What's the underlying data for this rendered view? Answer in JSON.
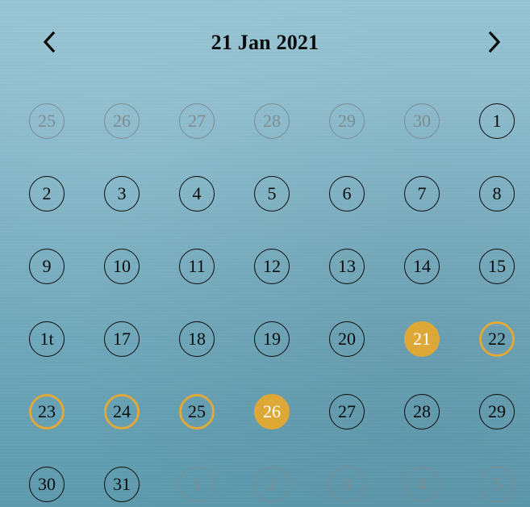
{
  "header": {
    "title": "21 Jan 2021",
    "prev_icon": "chevron-left-icon",
    "next_icon": "chevron-right-icon"
  },
  "colors": {
    "accent": "#dea836",
    "ring": "#e0a83a",
    "muted": "#7d8d92",
    "text": "#0b0b0b"
  },
  "weeks": [
    [
      {
        "label": "25",
        "state": "muted"
      },
      {
        "label": "26",
        "state": "muted"
      },
      {
        "label": "27",
        "state": "muted"
      },
      {
        "label": "28",
        "state": "muted"
      },
      {
        "label": "29",
        "state": "muted"
      },
      {
        "label": "30",
        "state": "muted"
      },
      {
        "label": "1",
        "state": "normal"
      }
    ],
    [
      {
        "label": "2",
        "state": "normal"
      },
      {
        "label": "3",
        "state": "normal"
      },
      {
        "label": "4",
        "state": "normal"
      },
      {
        "label": "5",
        "state": "normal"
      },
      {
        "label": "6",
        "state": "normal"
      },
      {
        "label": "7",
        "state": "normal"
      },
      {
        "label": "8",
        "state": "normal"
      }
    ],
    [
      {
        "label": "9",
        "state": "normal"
      },
      {
        "label": "10",
        "state": "normal"
      },
      {
        "label": "11",
        "state": "normal"
      },
      {
        "label": "12",
        "state": "normal"
      },
      {
        "label": "13",
        "state": "normal"
      },
      {
        "label": "14",
        "state": "normal"
      },
      {
        "label": "15",
        "state": "normal"
      }
    ],
    [
      {
        "label": "1t",
        "state": "normal"
      },
      {
        "label": "17",
        "state": "normal"
      },
      {
        "label": "18",
        "state": "normal"
      },
      {
        "label": "19",
        "state": "normal"
      },
      {
        "label": "20",
        "state": "normal"
      },
      {
        "label": "21",
        "state": "selected"
      },
      {
        "label": "22",
        "state": "ring"
      }
    ],
    [
      {
        "label": "23",
        "state": "ring"
      },
      {
        "label": "24",
        "state": "ring"
      },
      {
        "label": "25",
        "state": "ring"
      },
      {
        "label": "26",
        "state": "selected"
      },
      {
        "label": "27",
        "state": "normal"
      },
      {
        "label": "28",
        "state": "normal"
      },
      {
        "label": "29",
        "state": "normal"
      }
    ],
    [
      {
        "label": "30",
        "state": "normal"
      },
      {
        "label": "31",
        "state": "normal"
      },
      {
        "label": "1",
        "state": "muted"
      },
      {
        "label": "2",
        "state": "muted"
      },
      {
        "label": "3",
        "state": "muted"
      },
      {
        "label": "4",
        "state": "muted"
      },
      {
        "label": "5",
        "state": "muted"
      }
    ]
  ]
}
